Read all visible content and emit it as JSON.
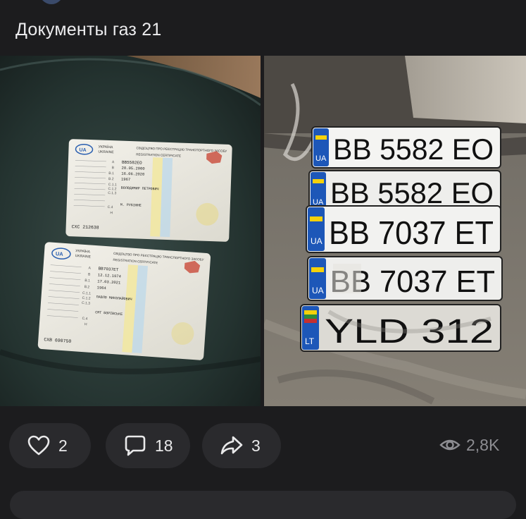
{
  "post": {
    "text": "Документы газ 21"
  },
  "documents": [
    {
      "header_ua": "УКРАЇНА",
      "header_en": "UKRAINE",
      "title": "СВІДОЦТВО ПРО РЕЄСТРАЦІЮ ТРАНСПОРТНОГО ЗАСОБУ",
      "title_en": "REGISTRATION CERTIFICATE",
      "plate": "BB5582EO",
      "date_b": "20.05.2000",
      "date_i": "16.06.2020",
      "year": "1967",
      "owner": "ВОЛОДИМИР ПЕТРОВИЧ",
      "city": "М. РУБІЖНЕ",
      "serial": "CXC 212638"
    },
    {
      "header_ua": "УКРАЇНА",
      "header_en": "UKRAINE",
      "title": "СВІДОЦТВО ПРО РЕЄСТРАЦІЮ ТРАНСПОРТНОГО ЗАСОБУ",
      "title_en": "REGISTRATION CERTIFICATE",
      "plate": "BB7037ET",
      "date_b": "12.12.1974",
      "date_i": "17.03.2021",
      "year": "1964",
      "owner": "ПАВЛО МИКОЛАЙОВИЧ",
      "city": "СМТ БОРІВСЬКЕ",
      "serial": "CXB 690750"
    }
  ],
  "plates": [
    {
      "country": "UA",
      "text": "BB 5582 EO"
    },
    {
      "country": "UA",
      "text": "BB 5582 EO"
    },
    {
      "country": "UA",
      "text": "BB 7037 ET"
    },
    {
      "country": "UA",
      "text": "BB 7037 ET"
    },
    {
      "country": "LT",
      "text": "YLD 312"
    }
  ],
  "actions": {
    "likes": "2",
    "comments": "18",
    "shares": "3",
    "views": "2,8K"
  },
  "icons": {
    "like": "heart-icon",
    "comment": "comment-icon",
    "share": "share-arrow-icon",
    "views": "eye-icon"
  },
  "colors": {
    "background": "#1c1c1e",
    "pill": "#2a2a2d",
    "text": "#e9e9ea",
    "muted": "#8d8d92",
    "ua_blue": "#1d57b8",
    "ua_yellow": "#f5d10a"
  }
}
